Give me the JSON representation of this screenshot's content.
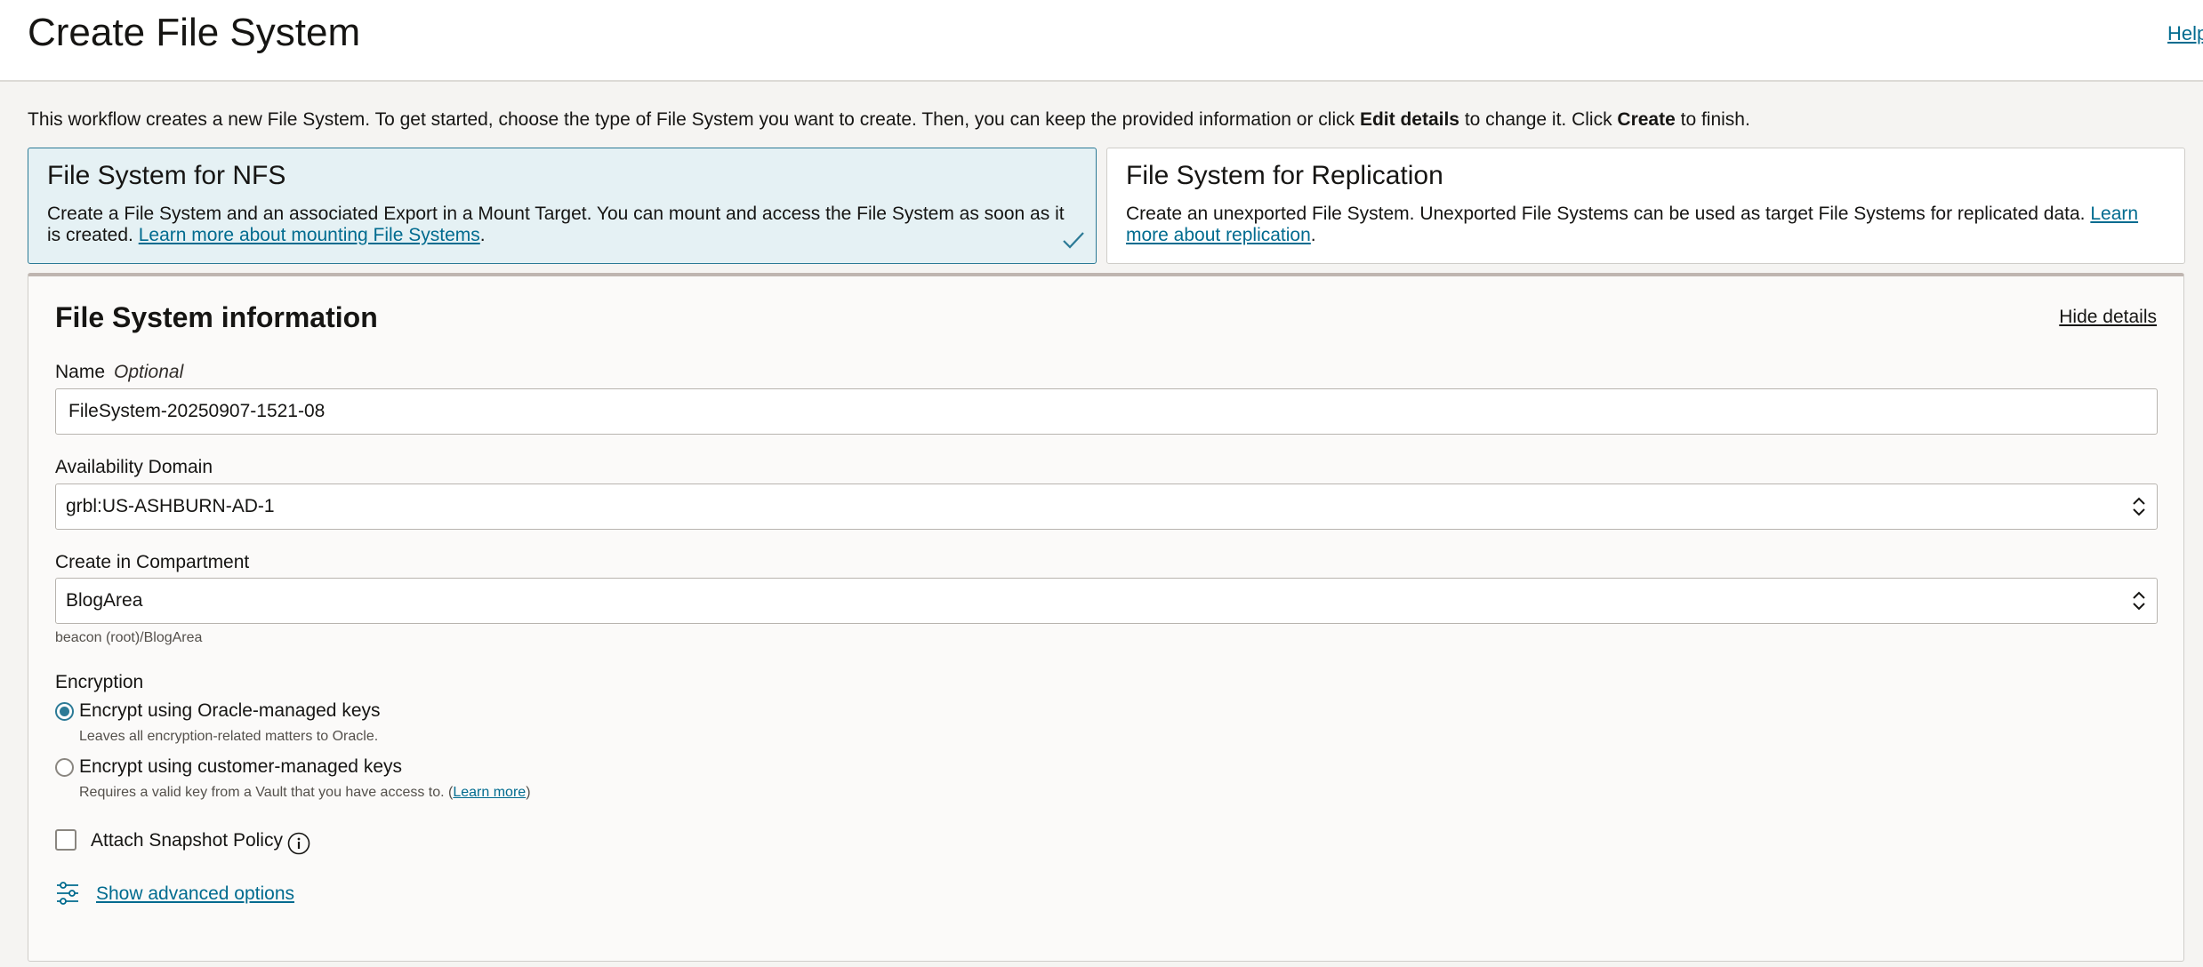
{
  "header": {
    "title": "Create File System",
    "help": "Help"
  },
  "intro": {
    "part1": "This workflow creates a new File System. To get started, choose the type of File System you want to create. Then, you can keep the provided information or click ",
    "bold1": "Edit details",
    "part2": " to change it. Click ",
    "bold2": "Create",
    "part3": " to finish."
  },
  "cards": {
    "nfs": {
      "title": "File System for NFS",
      "desc": "Create a File System and an associated Export in a Mount Target. You can mount and access the File System as soon as it is created. ",
      "link": "Learn more about mounting File Systems",
      "suffix": "."
    },
    "replication": {
      "title": "File System for Replication",
      "desc": "Create an unexported File System. Unexported File Systems can be used as target File Systems for replicated data. ",
      "link": "Learn more about replication",
      "suffix": "."
    }
  },
  "info": {
    "title": "File System information",
    "hide_details": "Hide details",
    "name_label": "Name",
    "name_optional": "Optional",
    "name_value": "FileSystem-20250907-1521-08",
    "ad_label": "Availability Domain",
    "ad_value": "grbl:US-ASHBURN-AD-1",
    "compartment_label": "Create in Compartment",
    "compartment_value": "BlogArea",
    "compartment_path": "beacon (root)/BlogArea",
    "encryption_label": "Encryption",
    "enc_oracle_label": "Encrypt using Oracle-managed keys",
    "enc_oracle_hint": "Leaves all encryption-related matters to Oracle.",
    "enc_customer_label": "Encrypt using customer-managed keys",
    "enc_customer_hint_pre": "Requires a valid key from a Vault that you have access to. (",
    "enc_customer_hint_link": "Learn more",
    "enc_customer_hint_post": ")",
    "snapshot_label": "Attach Snapshot Policy",
    "advanced_link": "Show advanced options"
  }
}
